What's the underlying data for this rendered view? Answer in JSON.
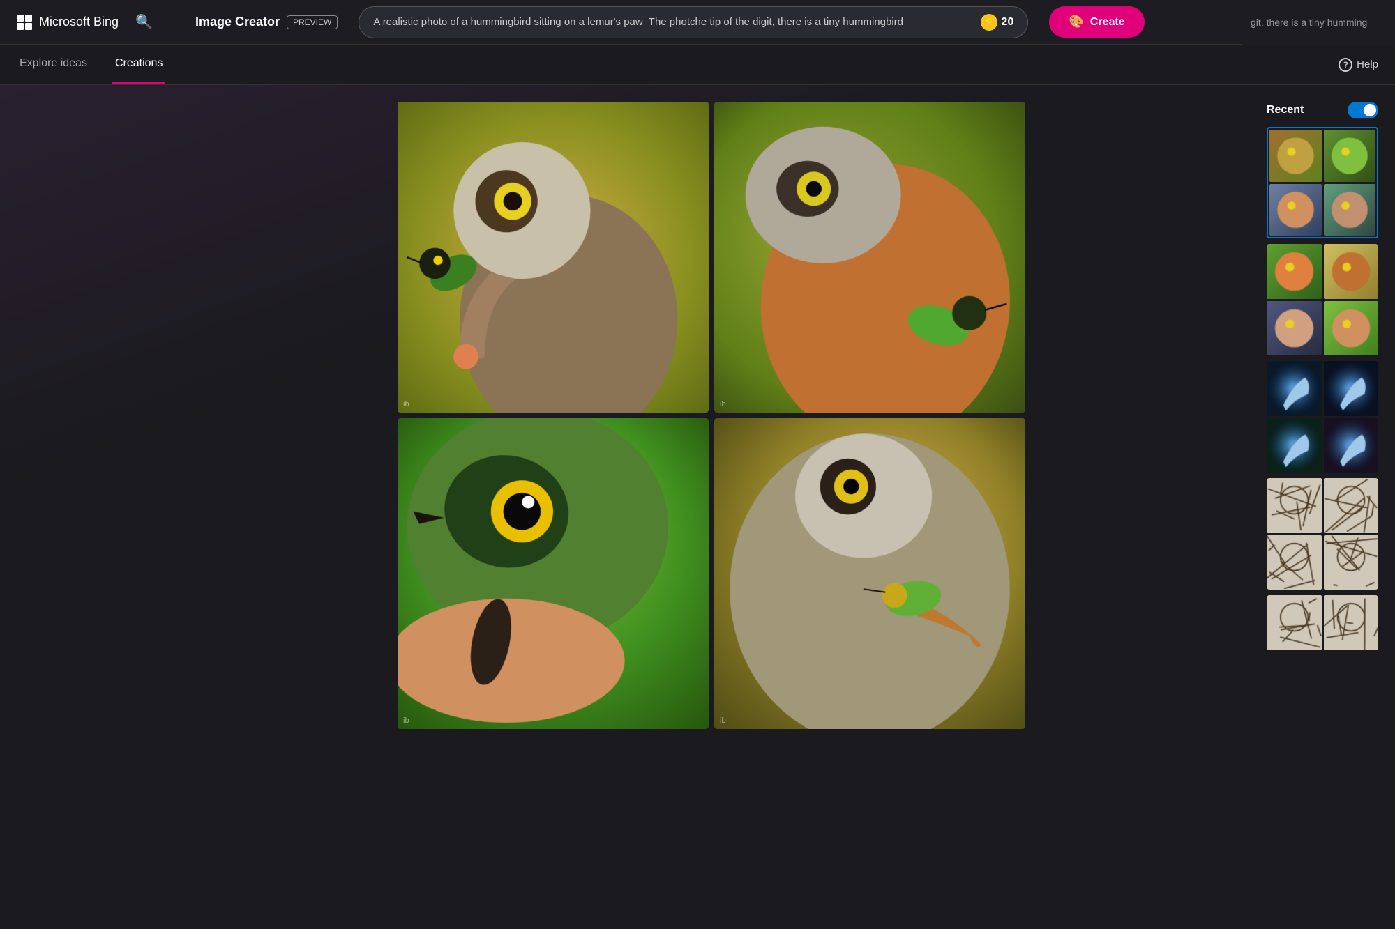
{
  "header": {
    "logo_text": "Microsoft Bing",
    "image_creator_label": "Image Creator",
    "preview_badge": "PREVIEW",
    "search_value": "A realistic photo of a hummingbird sitting on a lemur's paw  The photche tip of the digit, there is a tiny hummingbird",
    "token_count": "20",
    "create_button": "Create",
    "scroll_text": "git, there is a tiny humming"
  },
  "nav": {
    "explore_ideas": "Explore ideas",
    "creations": "Creations",
    "help": "Help"
  },
  "sidebar": {
    "recent_label": "Recent"
  },
  "images": {
    "watermark": "ib"
  }
}
